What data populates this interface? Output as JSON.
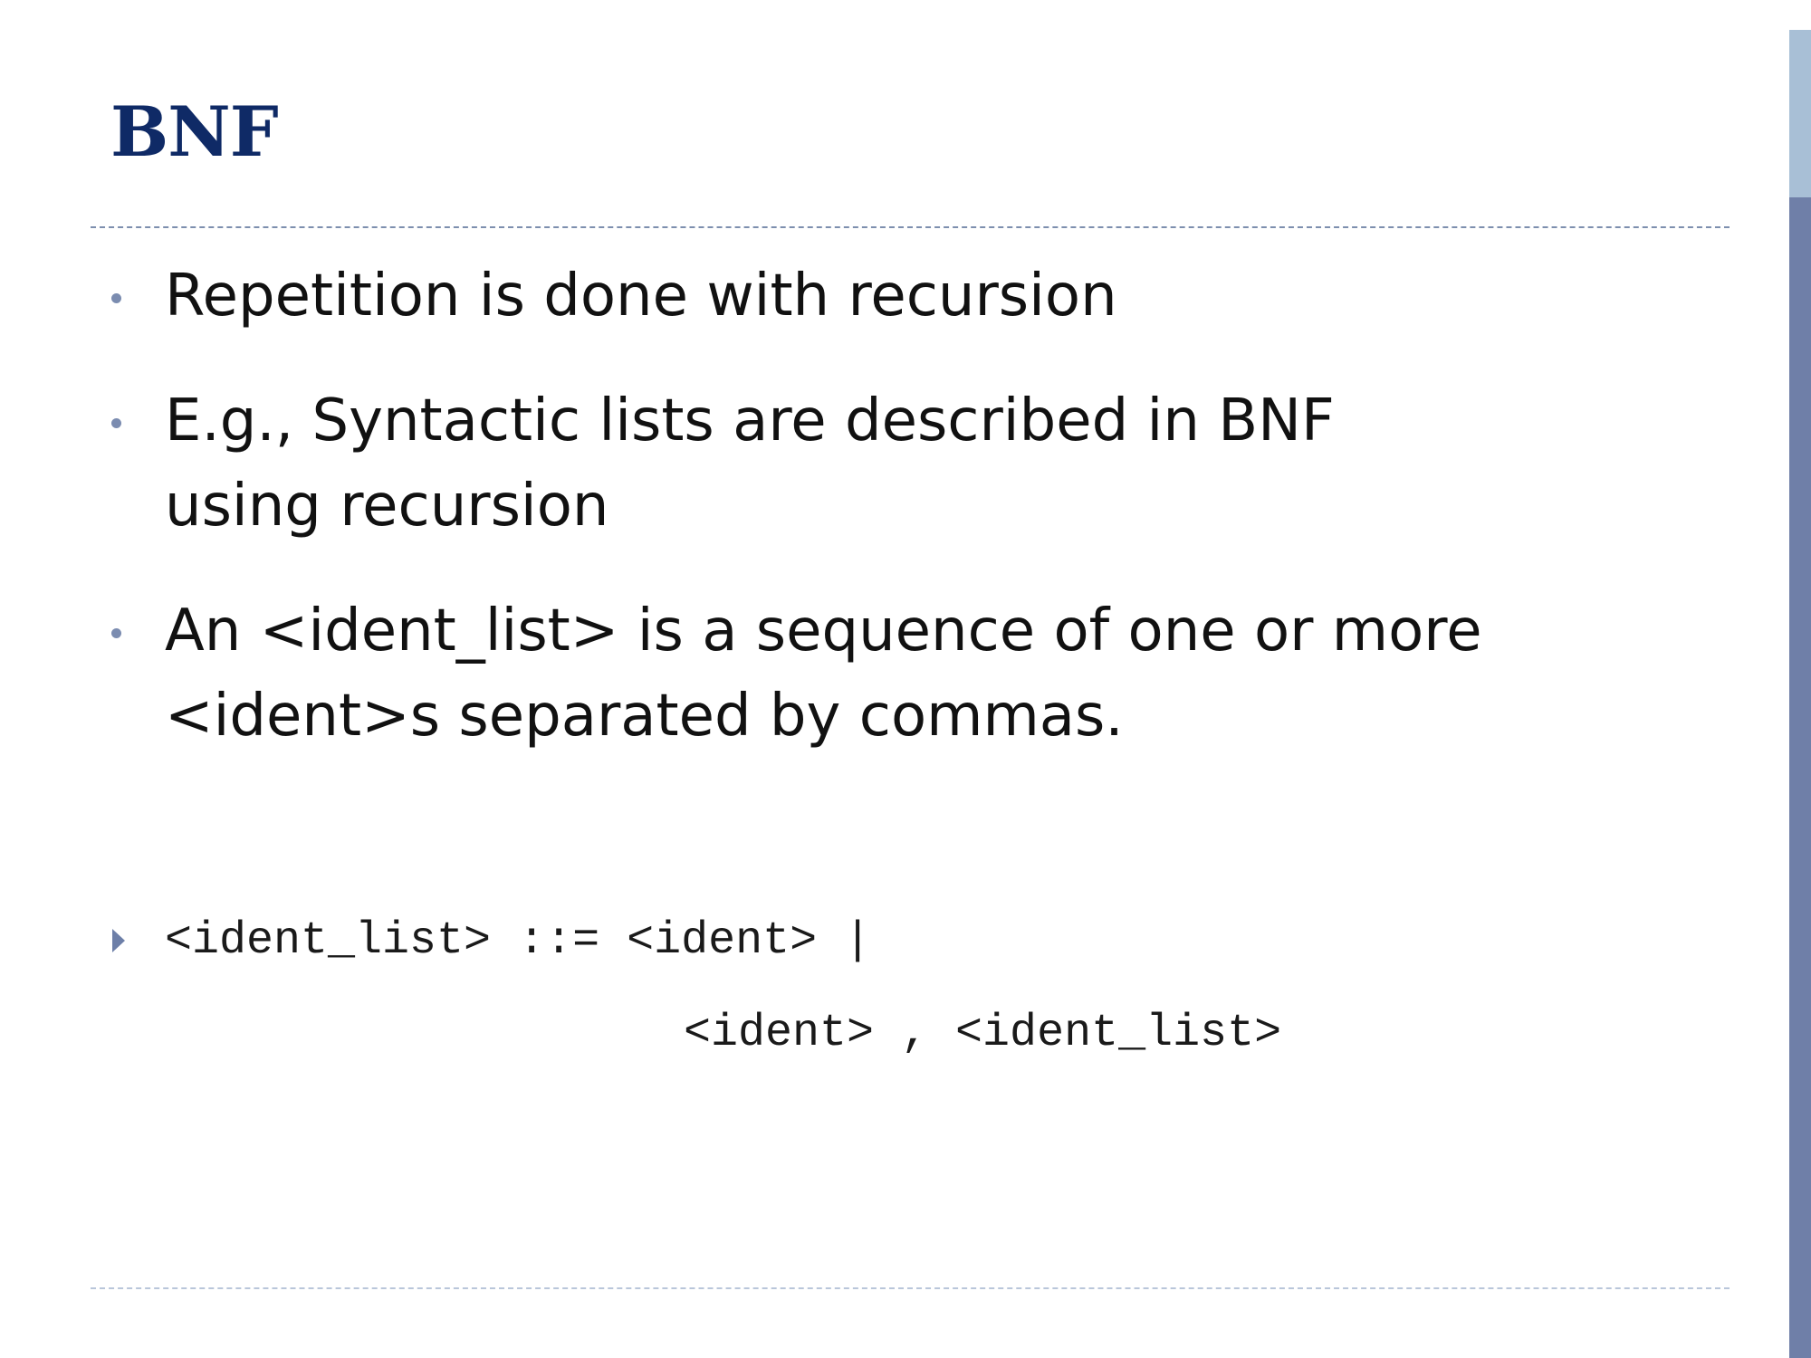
{
  "slide": {
    "title": "BNF",
    "bullets": [
      {
        "text": "Repetition is done with recursion"
      },
      {
        "text": "E.g., Syntactic lists are described in BNF using recursion"
      },
      {
        "text": "An <ident_list> is a sequence of one or more <ident>s separated by commas."
      }
    ],
    "code": {
      "line1": "<ident_list> ::= <ident> |",
      "line2": "<ident> , <ident_list>"
    }
  },
  "colors": {
    "title": "#0f2a66",
    "accent_bar": "#6f7fa8",
    "accent_bar_top": "#a8bfd6"
  }
}
